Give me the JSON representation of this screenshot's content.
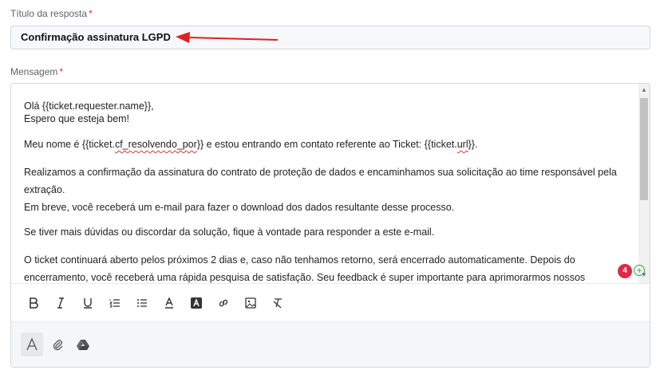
{
  "form": {
    "title_label": "Título da resposta",
    "title_value": "Confirmação assinatura LGPD",
    "message_label": "Mensagem",
    "required_mark": "*"
  },
  "message": {
    "greeting": "Olá {{ticket.requester.name}},",
    "line2": "Espero que esteja bem!",
    "p2_before": "Meu nome é {{ticket.",
    "p2_var1": "cf_resolvendo_por",
    "p2_mid": "}} e estou entrando em contato referente ao Ticket: {{ticket.",
    "p2_var2": "url",
    "p2_after": "}}.",
    "p3": "Realizamos a confirmação da assinatura do contrato de proteção de dados e encaminhamos sua solicitação ao time responsável pela extração.",
    "p3b": "Em breve, você receberá um e-mail para fazer o download dos dados resultante desse processo.",
    "p4": "Se tiver mais dúvidas ou discordar da solução, fique à vontade para responder a este e-mail.",
    "p5": "O ticket continuará aberto pelos próximos 2 dias e, caso não tenhamos retorno, será encerrado automaticamente. Depois do encerramento, você receberá uma rápida pesquisa de satisfação. Seu feedback é super importante para aprimorarmos nossos"
  },
  "grammar": {
    "count": "4"
  },
  "toolbar": {
    "icons": [
      "bold-icon",
      "italic-icon",
      "underline-icon",
      "ordered-list-icon",
      "bullet-list-icon",
      "text-color-icon",
      "highlight-icon",
      "link-icon",
      "image-icon",
      "clear-format-icon"
    ]
  },
  "footer": {
    "icons": [
      "text-format-icon",
      "attachment-icon",
      "google-drive-icon"
    ]
  },
  "colors": {
    "required": "#d93636",
    "arrow": "#e02020",
    "badge": "#e0294a",
    "grammar_ok": "#2ea44f"
  }
}
